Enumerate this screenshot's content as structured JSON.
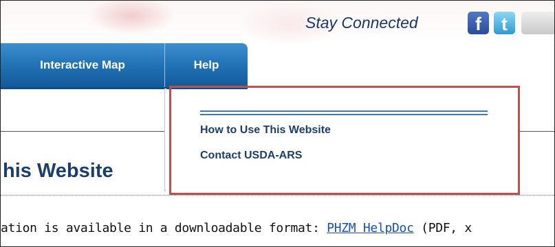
{
  "header": {
    "stay_connected": "Stay Connected",
    "facebook_glyph": "f",
    "twitter_glyph": "t",
    "icons": [
      "facebook-icon",
      "twitter-icon",
      "social-icon"
    ]
  },
  "nav": {
    "tabs": [
      {
        "label": "Interactive Map"
      },
      {
        "label": "Help"
      }
    ]
  },
  "dropdown": {
    "items": [
      {
        "label": "How to Use This Website"
      },
      {
        "label": "Contact USDA-ARS"
      }
    ]
  },
  "main": {
    "title_fragment": "his Website",
    "text_prefix": "ation is available in a downloadable format: ",
    "link_text": "PHZM HelpDoc",
    "text_suffix": " (PDF, x"
  },
  "colors": {
    "nav_blue": "#1f6fb3",
    "heading_navy": "#1a3e6e",
    "highlight_red": "#c0504d",
    "link_blue": "#1b4fb8"
  }
}
